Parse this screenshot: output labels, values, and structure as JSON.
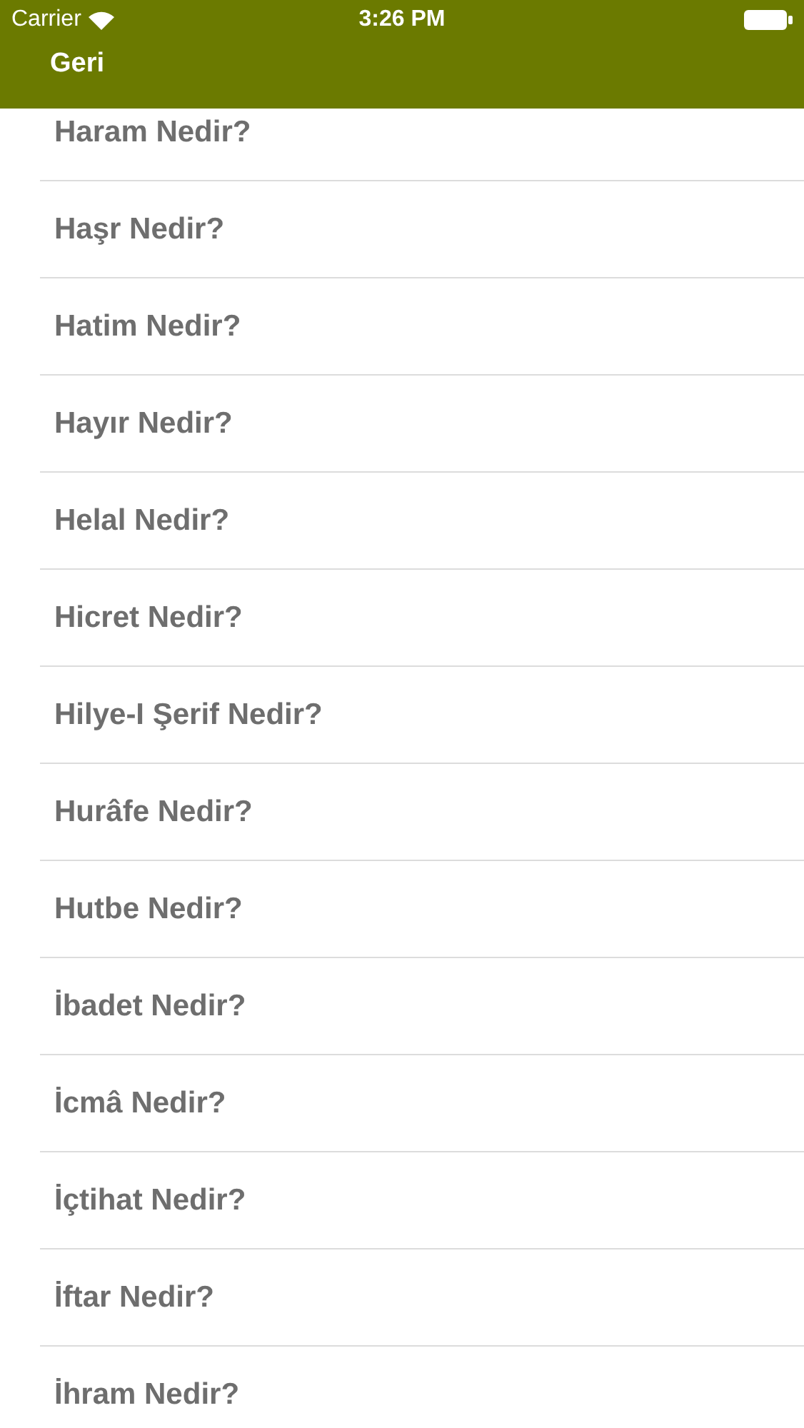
{
  "status_bar": {
    "carrier": "Carrier",
    "time": "3:26 PM"
  },
  "nav_bar": {
    "back": "Geri"
  },
  "items": [
    {
      "label": "Haram Nedir?"
    },
    {
      "label": "Haşr Nedir?"
    },
    {
      "label": "Hatim Nedir?"
    },
    {
      "label": "Hayır Nedir?"
    },
    {
      "label": "Helal Nedir?"
    },
    {
      "label": "Hicret Nedir?"
    },
    {
      "label": "Hilye-I Şerif Nedir?"
    },
    {
      "label": "Hurâfe Nedir?"
    },
    {
      "label": "Hutbe Nedir?"
    },
    {
      "label": "İbadet Nedir?"
    },
    {
      "label": "İcmâ Nedir?"
    },
    {
      "label": "İçtihat Nedir?"
    },
    {
      "label": "İftar Nedir?"
    },
    {
      "label": "İhram Nedir?"
    }
  ]
}
